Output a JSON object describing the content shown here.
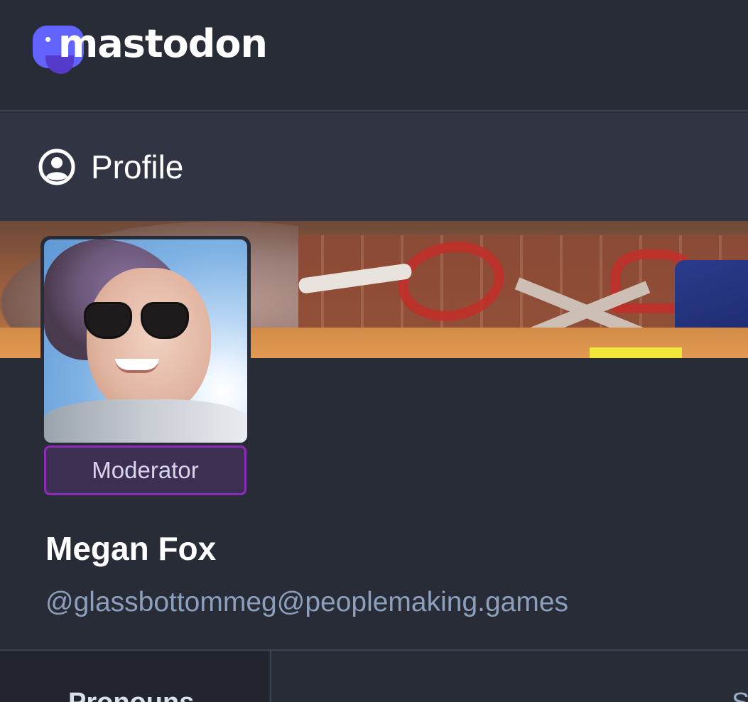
{
  "app": {
    "logo_text": "mastodon",
    "logo_icon": "mastodon-logo-icon"
  },
  "header": {
    "icon": "user-circle-icon",
    "title": "Profile"
  },
  "profile": {
    "banner_image": "header-banner",
    "avatar_image": "avatar",
    "role_badge": "Moderator",
    "display_name": "Megan Fox",
    "handle": "@glassbottommeg@peoplemaking.games"
  },
  "fields": [
    {
      "key": "Pronouns",
      "value": "S"
    }
  ],
  "colors": {
    "background": "#282c37",
    "header_bg": "#313543",
    "accent": "#6364ff",
    "badge_border": "#8c2cb8",
    "handle_text": "#8ca0bd"
  }
}
